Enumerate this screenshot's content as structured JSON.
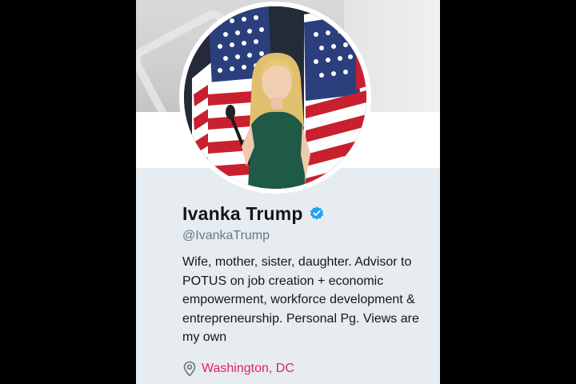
{
  "profile": {
    "name": "Ivanka Trump",
    "handle": "@IvankaTrump",
    "bio": "Wife, mother, sister, daughter. Advisor to POTUS on job creation + economic empowerment, workforce development & entrepreneurship. Personal Pg. Views are my own",
    "location": "Washington, DC"
  },
  "icons": {
    "verified": "verified-badge-icon",
    "location": "location-pin-icon"
  },
  "colors": {
    "panel_background": "#e6ecf0",
    "verified_blue": "#1da1f2",
    "location_link": "#e0245e",
    "handle_gray": "#657786"
  }
}
